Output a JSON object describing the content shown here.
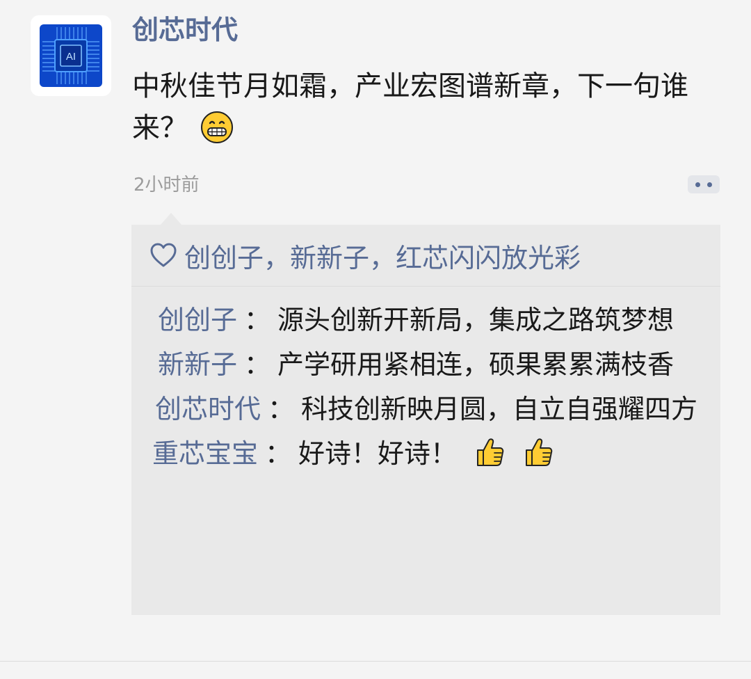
{
  "post": {
    "author": "创芯时代",
    "text": "中秋佳节月如霜，产业宏图谱新章，下一句谁来？",
    "emoji": "grinning-face",
    "time": "2小时前"
  },
  "avatar": {
    "label": "AI",
    "icon": "ai-chip-icon"
  },
  "likes": {
    "names": "创创子，新新子，红芯闪闪放光彩"
  },
  "comments": [
    {
      "name": "创创子",
      "sep": "：",
      "text": "源头创新开新局，集成之路筑梦想"
    },
    {
      "name": "新新子",
      "sep": "：",
      "text": "产学研用紧相连，硕果累累满枝香"
    },
    {
      "name": "创芯时代",
      "sep": "：",
      "text": "科技创新映月圆，自立自强耀四方"
    },
    {
      "name": "重芯宝宝",
      "sep": "：",
      "text": "好诗！好诗！",
      "emoji": [
        "thumbs-up",
        "thumbs-up"
      ]
    }
  ],
  "colors": {
    "link": "#576b95",
    "text": "#191919",
    "muted": "#9b9b9b",
    "panel": "#e9e9e9",
    "background": "#f4f4f4"
  }
}
